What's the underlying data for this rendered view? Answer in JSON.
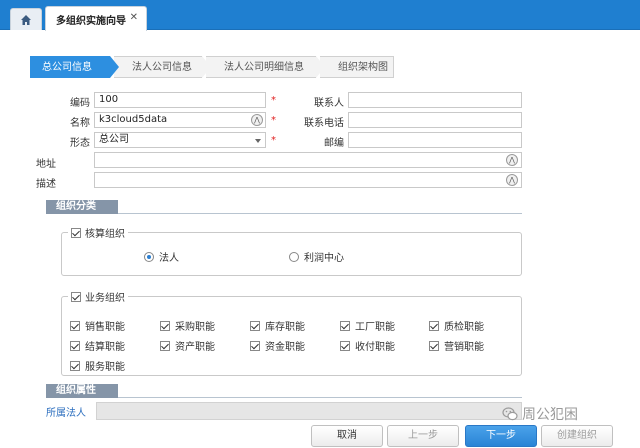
{
  "tabs": {
    "home_icon": "home-icon",
    "active_label": "多组织实施向导",
    "close_glyph": "✕"
  },
  "steps": [
    {
      "label": "总公司信息",
      "active": true
    },
    {
      "label": "法人公司信息",
      "active": false
    },
    {
      "label": "法人公司明细信息",
      "active": false
    },
    {
      "label": "组织架构图",
      "active": false
    }
  ],
  "form": {
    "code_label": "编码",
    "code_value": "100",
    "name_label": "名称",
    "name_value": "k3cloud5data",
    "form_label": "形态",
    "form_value": "总公司",
    "address_label": "地址",
    "address_value": "",
    "desc_label": "描述",
    "desc_value": "",
    "contact_label": "联系人",
    "contact_value": "",
    "phone_label": "联系电话",
    "phone_value": "",
    "zip_label": "邮编",
    "zip_value": "",
    "required_mark": "*"
  },
  "classification": {
    "section_label": "组织分类",
    "accounting": {
      "title": "核算组织",
      "checked": true,
      "options": [
        {
          "label": "法人",
          "selected": true
        },
        {
          "label": "利润中心",
          "selected": false
        }
      ]
    },
    "business": {
      "title": "业务组织",
      "checked": true,
      "functions": [
        {
          "label": "销售职能",
          "checked": true
        },
        {
          "label": "采购职能",
          "checked": true
        },
        {
          "label": "库存职能",
          "checked": true
        },
        {
          "label": "工厂职能",
          "checked": true
        },
        {
          "label": "质检职能",
          "checked": true
        },
        {
          "label": "结算职能",
          "checked": true
        },
        {
          "label": "资产职能",
          "checked": true
        },
        {
          "label": "资金职能",
          "checked": true
        },
        {
          "label": "收付职能",
          "checked": true
        },
        {
          "label": "营销职能",
          "checked": true
        },
        {
          "label": "服务职能",
          "checked": true
        }
      ]
    }
  },
  "attributes": {
    "section_label": "组织属性",
    "affiliation_label": "所属法人",
    "affiliation_value": ""
  },
  "buttons": {
    "cancel": "取消",
    "prev": "上一步",
    "next": "下一步",
    "create": "创建组织"
  },
  "watermark": {
    "text": "周公犯困",
    "icon": "wechat-icon"
  },
  "colors": {
    "topbar": "#1f7fd0",
    "active_step": "#2d8fe0",
    "section_tag": "#8595a8",
    "required": "#e02020",
    "link": "#2d6fbf"
  }
}
